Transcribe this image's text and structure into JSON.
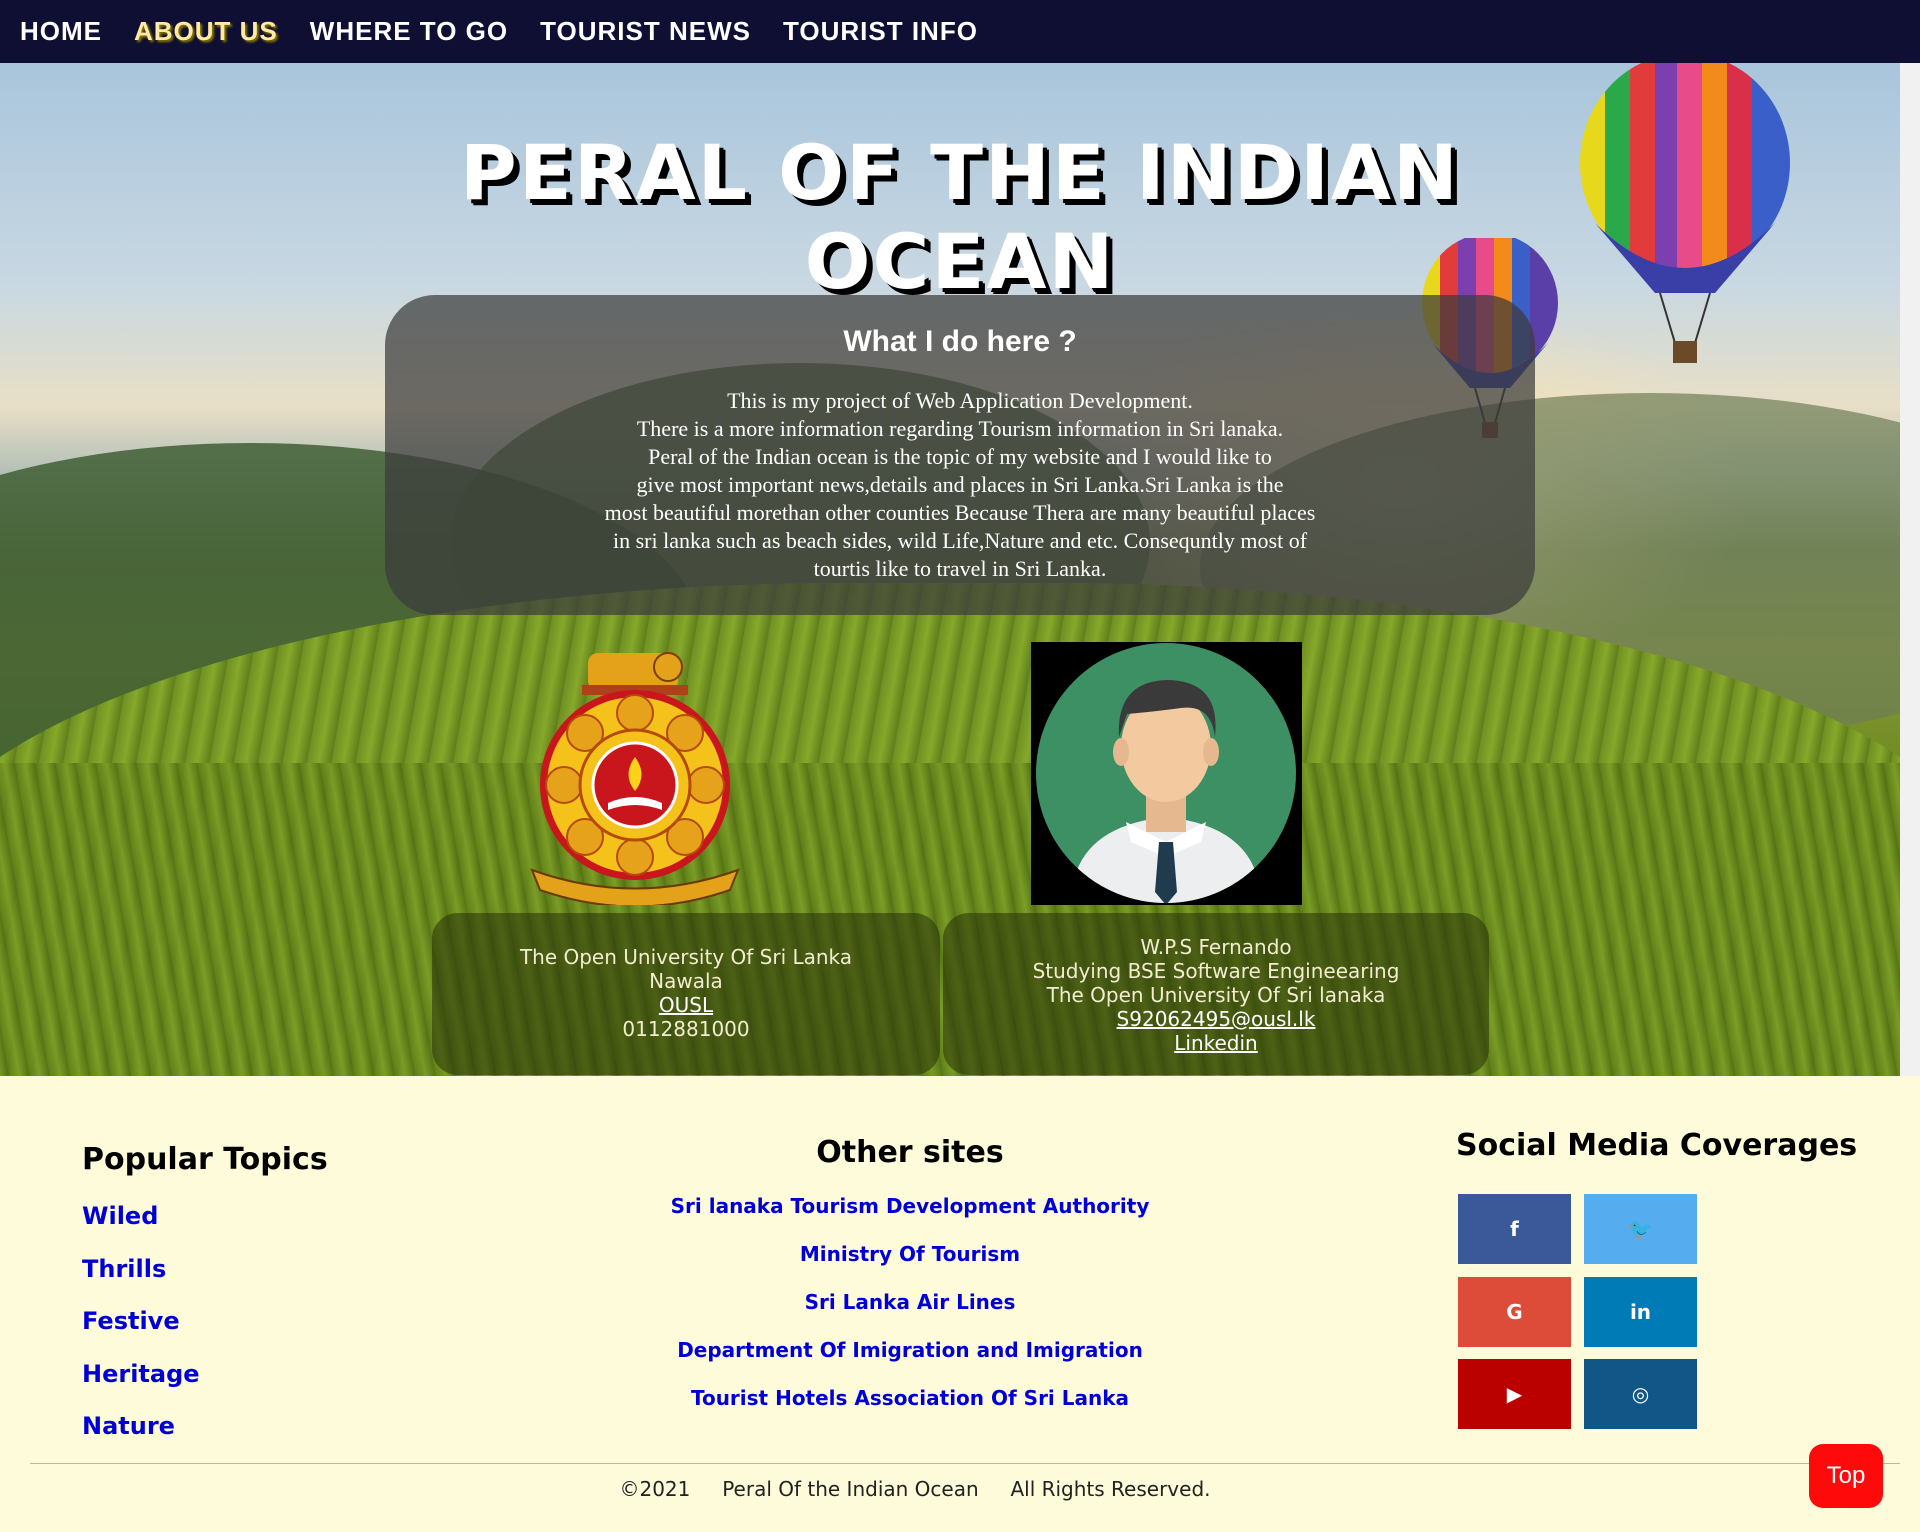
{
  "nav": {
    "items": [
      {
        "label": "HOME"
      },
      {
        "label": "ABOUT US"
      },
      {
        "label": "WHERE TO GO"
      },
      {
        "label": "TOURIST NEWS"
      },
      {
        "label": "TOURIST INFO"
      }
    ],
    "active": "ABOUT US"
  },
  "hero": {
    "title": "PERAL OF THE INDIAN OCEAN",
    "intro_heading": "What I do here ?",
    "intro_lines": [
      "This is my project of Web Application Development.",
      "There is a more information regarding Tourism information in Sri lanaka.",
      "Peral of the Indian ocean is the topic of my website and I would like to",
      "give most important news,details and places in Sri Lanka.Sri Lanka is the",
      "most beautiful morethan other counties Because Thera are many beautiful places",
      "in sri lanka such as beach sides, wild Life,Nature and etc. Consequntly most of",
      "tourtis like to travel in Sri Lanka."
    ]
  },
  "university_card": {
    "name": "The Open University Of Sri Lanka",
    "location": "Nawala",
    "link": "OUSL",
    "phone": "0112881000",
    "logo_icon": "university-crest-icon"
  },
  "author_card": {
    "name": "W.P.S Fernando",
    "course": "Studying BSE Software Engineearing",
    "university": "The Open University Of Sri lanaka",
    "email": "S92062495@ousl.lk",
    "linkedin": "Linkedin",
    "avatar_icon": "user-avatar-icon"
  },
  "footer": {
    "popular_heading": "Popular Topics",
    "popular_topics": [
      "Wiled",
      "Thrills",
      "Festive",
      "Heritage",
      "Nature"
    ],
    "other_heading": "Other sites",
    "other_sites": [
      "Sri lanaka Tourism Development Authority",
      "Ministry Of Tourism",
      "Sri Lanka Air Lines",
      "Department Of Imigration and Imigration",
      "Tourist Hotels Association Of Sri Lanka"
    ],
    "social_heading": "Social Media Coverages",
    "social": [
      {
        "icon": "facebook-icon",
        "glyph": "f",
        "color": "#3b5998"
      },
      {
        "icon": "twitter-icon",
        "glyph": "🐦",
        "color": "#55acee"
      },
      {
        "icon": "google-icon",
        "glyph": "G",
        "color": "#dd4b39"
      },
      {
        "icon": "linkedin-icon",
        "glyph": "in",
        "color": "#007bb5"
      },
      {
        "icon": "youtube-icon",
        "glyph": "▶",
        "color": "#bb0000"
      },
      {
        "icon": "instagram-icon",
        "glyph": "◎",
        "color": "#125688"
      }
    ],
    "copyright_year": "©2021",
    "copyright_name": "Peral Of the Indian Ocean",
    "copyright_rights": "All Rights Reserved.",
    "top_button": "Top"
  }
}
